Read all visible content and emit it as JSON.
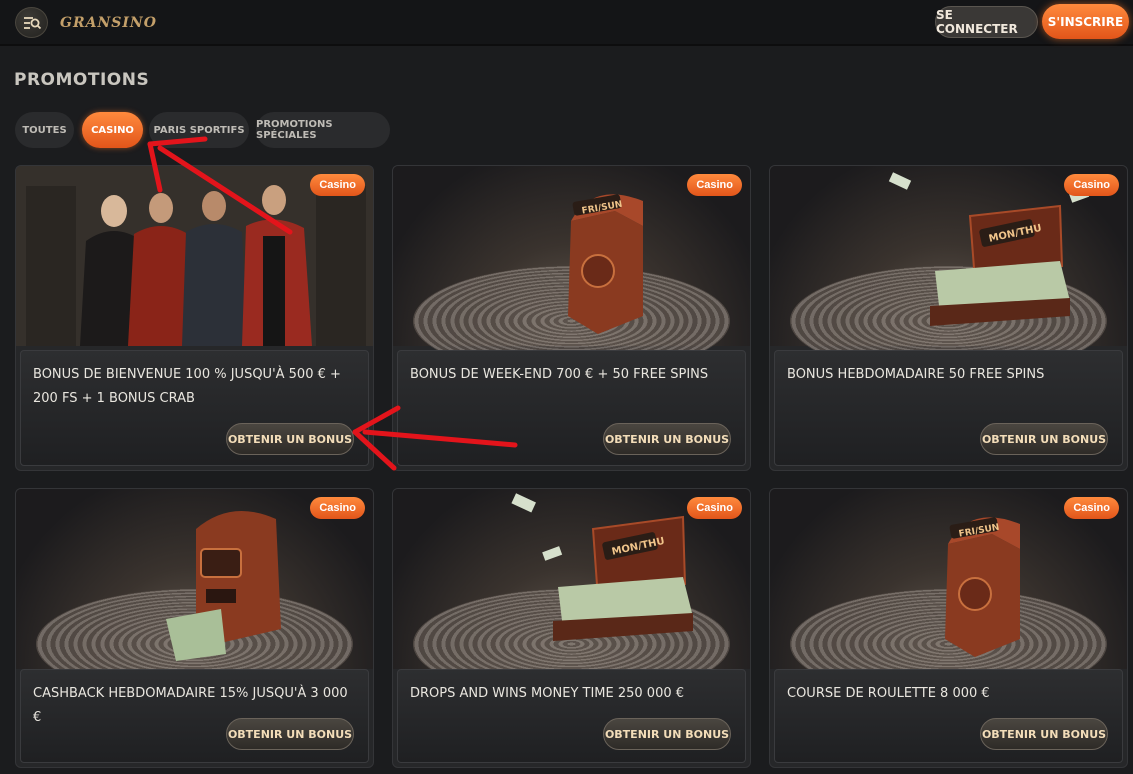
{
  "header": {
    "logo_text": "GRANSINO",
    "login_label": "SE CONNECTER",
    "register_label": "S'INSCRIRE"
  },
  "page_title": "PROMOTIONS",
  "tabs": [
    {
      "label": "TOUTES",
      "active": false
    },
    {
      "label": "CASINO",
      "active": true
    },
    {
      "label": "PARIS SPORTIFS",
      "active": false
    },
    {
      "label": "PROMOTIONS SPÉCIALES",
      "active": false
    }
  ],
  "cards": [
    {
      "badge": "Casino",
      "title": "BONUS DE BIENVENUE 100 % JUSQU'À 500 € + 200 FS + 1 BONUS CRAB",
      "cta": "OBTENIR UN BONUS"
    },
    {
      "badge": "Casino",
      "title": "BONUS DE WEEK-END 700 € + 50 FREE SPINS",
      "cta": "OBTENIR UN BONUS"
    },
    {
      "badge": "Casino",
      "title": "BONUS HEBDOMADAIRE 50 FREE SPINS",
      "cta": "OBTENIR UN BONUS"
    },
    {
      "badge": "Casino",
      "title": "CASHBACK HEBDOMADAIRE 15% JUSQU'À 3 000 €",
      "cta": "OBTENIR UN BONUS"
    },
    {
      "badge": "Casino",
      "title": "DROPS AND WINS MONEY TIME 250 000 €",
      "cta": "OBTENIR UN BONUS"
    },
    {
      "badge": "Casino",
      "title": "COURSE DE ROULETTE 8 000 €",
      "cta": "OBTENIR UN BONUS"
    }
  ],
  "card_images": [
    "people",
    "safe",
    "money-case",
    "slot-machine",
    "money-case",
    "safe"
  ],
  "image_labels": {
    "safe": "FRI/SUN",
    "money_case": "MON/THU"
  },
  "colors": {
    "accent": "#f07a30",
    "background": "#1b1c1e",
    "annotation_arrow": "#e3141b"
  }
}
